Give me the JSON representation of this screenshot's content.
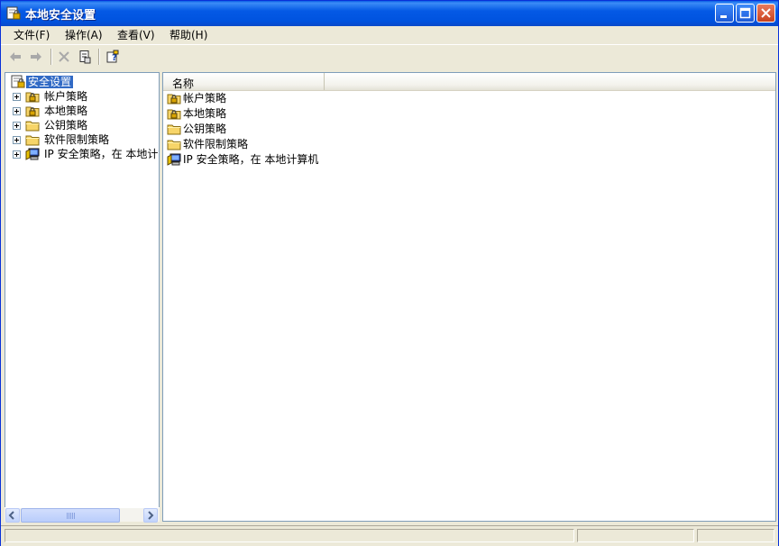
{
  "window": {
    "title": "本地安全设置",
    "app_icon": "security-settings-icon",
    "controls": {
      "minimize": "minimize-icon",
      "maximize": "maximize-icon",
      "close": "close-icon"
    }
  },
  "menu": {
    "items": [
      {
        "label": "文件(F)"
      },
      {
        "label": "操作(A)"
      },
      {
        "label": "查看(V)"
      },
      {
        "label": "帮助(H)"
      }
    ]
  },
  "toolbar": {
    "tools": [
      {
        "icon": "back-arrow-icon",
        "enabled": false
      },
      {
        "icon": "forward-arrow-icon",
        "enabled": false
      },
      {
        "icon": "delete-x-icon",
        "enabled": false
      },
      {
        "icon": "properties-icon",
        "enabled": true
      },
      {
        "icon": "help-icon",
        "enabled": true
      }
    ]
  },
  "tree": {
    "root": {
      "label": "安全设置",
      "icon": "security-settings-icon",
      "selected": true
    },
    "children": [
      {
        "label": "帐户策略",
        "icon": "locked-folder-icon"
      },
      {
        "label": "本地策略",
        "icon": "locked-folder-icon"
      },
      {
        "label": "公钥策略",
        "icon": "folder-icon"
      },
      {
        "label": "软件限制策略",
        "icon": "folder-icon"
      },
      {
        "label": "IP 安全策略，在 本地计算机",
        "icon": "ip-security-icon"
      }
    ]
  },
  "list": {
    "column_header": "名称",
    "rows": [
      {
        "label": "帐户策略",
        "icon": "locked-folder-icon"
      },
      {
        "label": "本地策略",
        "icon": "locked-folder-icon"
      },
      {
        "label": "公钥策略",
        "icon": "folder-icon"
      },
      {
        "label": "软件限制策略",
        "icon": "folder-icon"
      },
      {
        "label": "IP 安全策略，在 本地计算机",
        "icon": "ip-security-icon"
      }
    ]
  },
  "colors": {
    "titlebar": "#0053df",
    "selection": "#316ac5",
    "folder": "#f7d569",
    "window_bg": "#ece9d8"
  }
}
